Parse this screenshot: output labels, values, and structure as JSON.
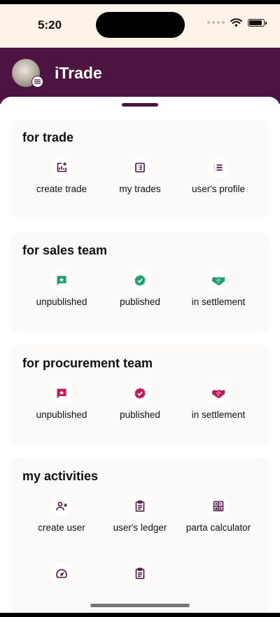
{
  "status_bar": {
    "time": "5:20"
  },
  "header": {
    "title": "iTrade"
  },
  "colors": {
    "brand": "#4d1442",
    "sales_accent": "#1e9e6b",
    "procurement_accent": "#c2185b",
    "status_bg": "#fdf3e8"
  },
  "sections": {
    "trade": {
      "title": "for trade",
      "items": [
        {
          "label": "create trade",
          "icon": "add-chart-icon"
        },
        {
          "label": "my trades",
          "icon": "list-alt-icon"
        },
        {
          "label": "user's profile",
          "icon": "list-icon"
        }
      ]
    },
    "sales": {
      "title": "for sales team",
      "items": [
        {
          "label": "unpublished",
          "icon": "star-chat-icon"
        },
        {
          "label": "published",
          "icon": "verified-check-icon"
        },
        {
          "label": "in settlement",
          "icon": "handshake-icon"
        }
      ]
    },
    "procurement": {
      "title": "for procurement team",
      "items": [
        {
          "label": "unpublished",
          "icon": "star-chat-icon"
        },
        {
          "label": "published",
          "icon": "verified-check-icon"
        },
        {
          "label": "in settlement",
          "icon": "handshake-icon"
        }
      ]
    },
    "activities": {
      "title": "my activities",
      "items": [
        {
          "label": "create user",
          "icon": "add-user-icon"
        },
        {
          "label": "user's ledger",
          "icon": "clipboard-icon"
        },
        {
          "label": "parta calculator",
          "icon": "calculator-icon"
        },
        {
          "label": "",
          "icon": "speed-gauge-icon"
        },
        {
          "label": "",
          "icon": "clipboard-icon"
        }
      ]
    }
  }
}
